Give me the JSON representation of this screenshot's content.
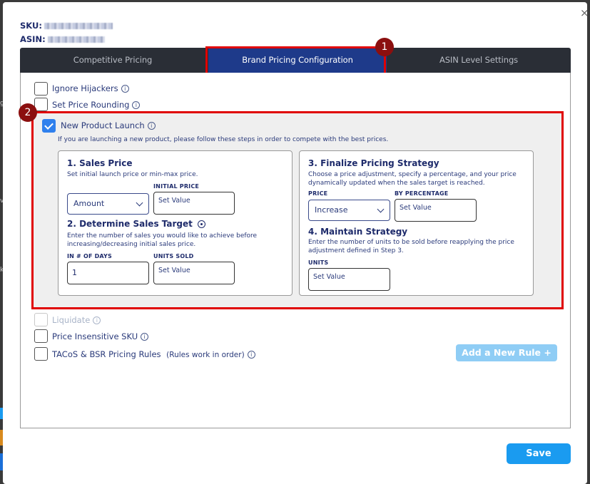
{
  "header": {
    "sku_label": "SKU:",
    "asin_label": "ASIN:",
    "close_glyph": "×"
  },
  "tabs": [
    {
      "label": "Competitive Pricing",
      "active": false
    },
    {
      "label": "Brand Pricing Configuration",
      "active": true
    },
    {
      "label": "ASIN Level Settings",
      "active": false
    }
  ],
  "annotations": {
    "badge_1": "1",
    "badge_2": "2"
  },
  "options": {
    "ignore_hijackers": {
      "label": "Ignore Hijackers",
      "checked": false
    },
    "set_price_rounding": {
      "label": "Set Price Rounding",
      "checked": false
    },
    "new_product_launch": {
      "label": "New Product Launch",
      "checked": true,
      "description": "If you are launching a new product, please follow these steps in order to compete with the best prices."
    },
    "liquidate": {
      "label": "Liquidate",
      "checked": false,
      "disabled": true
    },
    "price_insensitive": {
      "label": "Price Insensitive SKU",
      "checked": false
    },
    "tacos_bsr": {
      "label": "TACoS & BSR Pricing Rules",
      "sublabel": "(Rules work in order)",
      "checked": false
    }
  },
  "steps": {
    "sales_price": {
      "title": "1. Sales Price",
      "description": "Set initial launch price or min-max price.",
      "select_value": "Amount",
      "field_label": "INITIAL PRICE",
      "field_placeholder": "Set Value"
    },
    "sales_target": {
      "title": "2. Determine Sales Target",
      "description": "Enter the number of sales you would like to achieve before increasing/decreasing initial sales price.",
      "days_label": "IN # OF DAYS",
      "days_value": "1",
      "units_label": "UNITS SOLD",
      "units_placeholder": "Set Value"
    },
    "finalize": {
      "title": "3. Finalize Pricing Strategy",
      "description": "Choose a price adjustment, specify a percentage, and your price dynamically updated when the sales target is reached.",
      "price_label": "PRICE",
      "price_value": "Increase",
      "pct_label": "BY PERCENTAGE",
      "pct_placeholder": "Set Value"
    },
    "maintain": {
      "title": "4. Maintain Strategy",
      "description": "Enter the number of units to be sold before reapplying the price adjustment defined in Step 3.",
      "units_label": "UNITS",
      "units_placeholder": "Set Value"
    }
  },
  "buttons": {
    "add_rule": "Add a New Rule +",
    "save": "Save"
  },
  "colors": {
    "accent": "#1a9bf0",
    "active_tab": "#1e3a8a",
    "highlight": "#e00000",
    "badge": "#8b0f0f"
  }
}
